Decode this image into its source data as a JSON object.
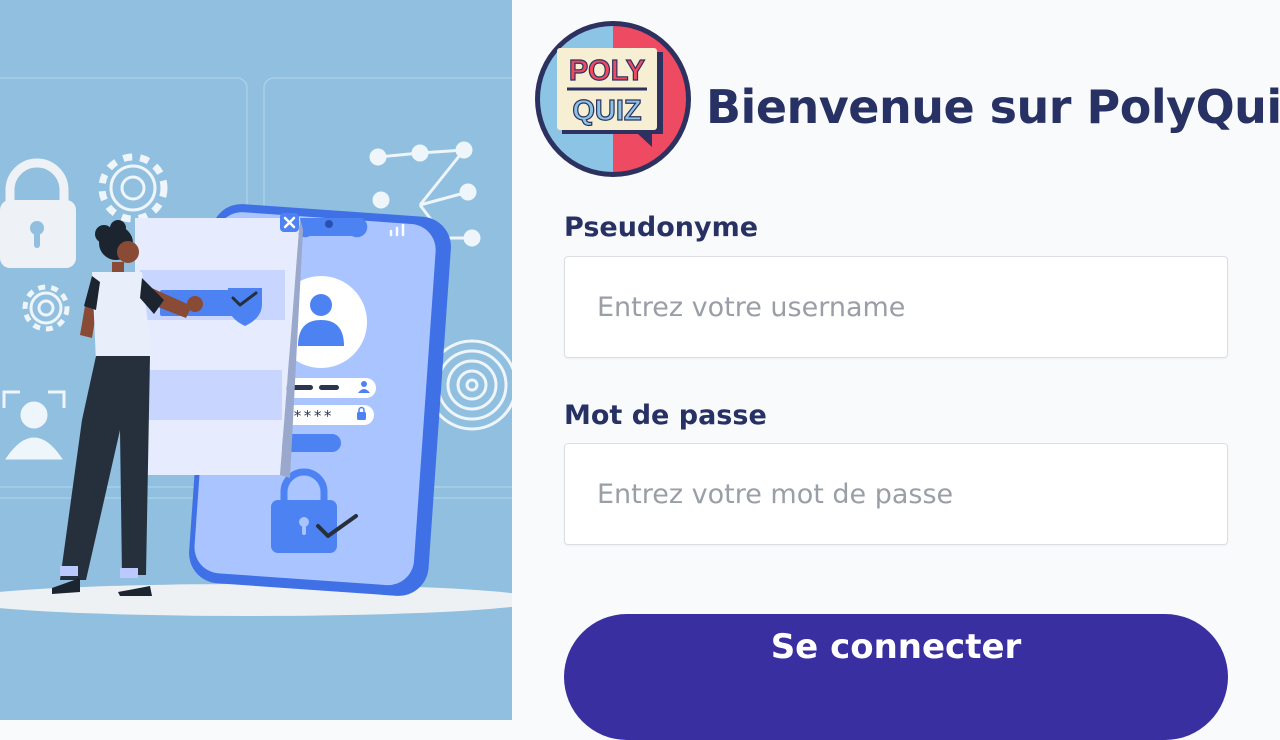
{
  "header": {
    "title": "Bienvenue sur PolyQuiz",
    "logo_text_top": "POLY",
    "logo_text_bottom": "QUIZ"
  },
  "form": {
    "username": {
      "label": "Pseudonyme",
      "placeholder": "Entrez votre username",
      "value": ""
    },
    "password": {
      "label": "Mot de passe",
      "placeholder": "Entrez votre mot de passe",
      "value": ""
    },
    "submit_label": "Se connecter"
  },
  "illustration": {
    "masked_password": "*****",
    "icons": [
      "padlock-icon",
      "gear-icon",
      "network-icon",
      "fingerprint-icon",
      "user-profile-icon",
      "shield-check-icon",
      "close-icon"
    ]
  },
  "colors": {
    "illustration_bg": "#90bfdf",
    "title": "#283164",
    "button": "#3a2fa0",
    "phone": "#4d82f3",
    "logo_left": "#8cc4e6",
    "logo_right": "#ee4a62"
  }
}
